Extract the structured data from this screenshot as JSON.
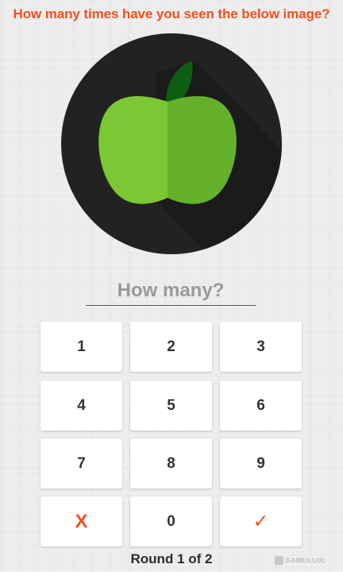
{
  "question": "How many times have you seen the below image?",
  "image": {
    "icon": "green-apple-icon"
  },
  "answer": {
    "placeholder": "How many?"
  },
  "keypad": {
    "keys": [
      "1",
      "2",
      "3",
      "4",
      "5",
      "6",
      "7",
      "8",
      "9"
    ],
    "clear_label": "X",
    "zero_label": "0",
    "submit_label": "✓"
  },
  "round_label": "Round 1 of 2",
  "watermark": "GAMES.LOL",
  "colors": {
    "accent": "#f0511e",
    "circle_bg": "#222222",
    "apple_light": "#7cc834",
    "apple_dark": "#66b12b",
    "leaf": "#0d5e12"
  }
}
